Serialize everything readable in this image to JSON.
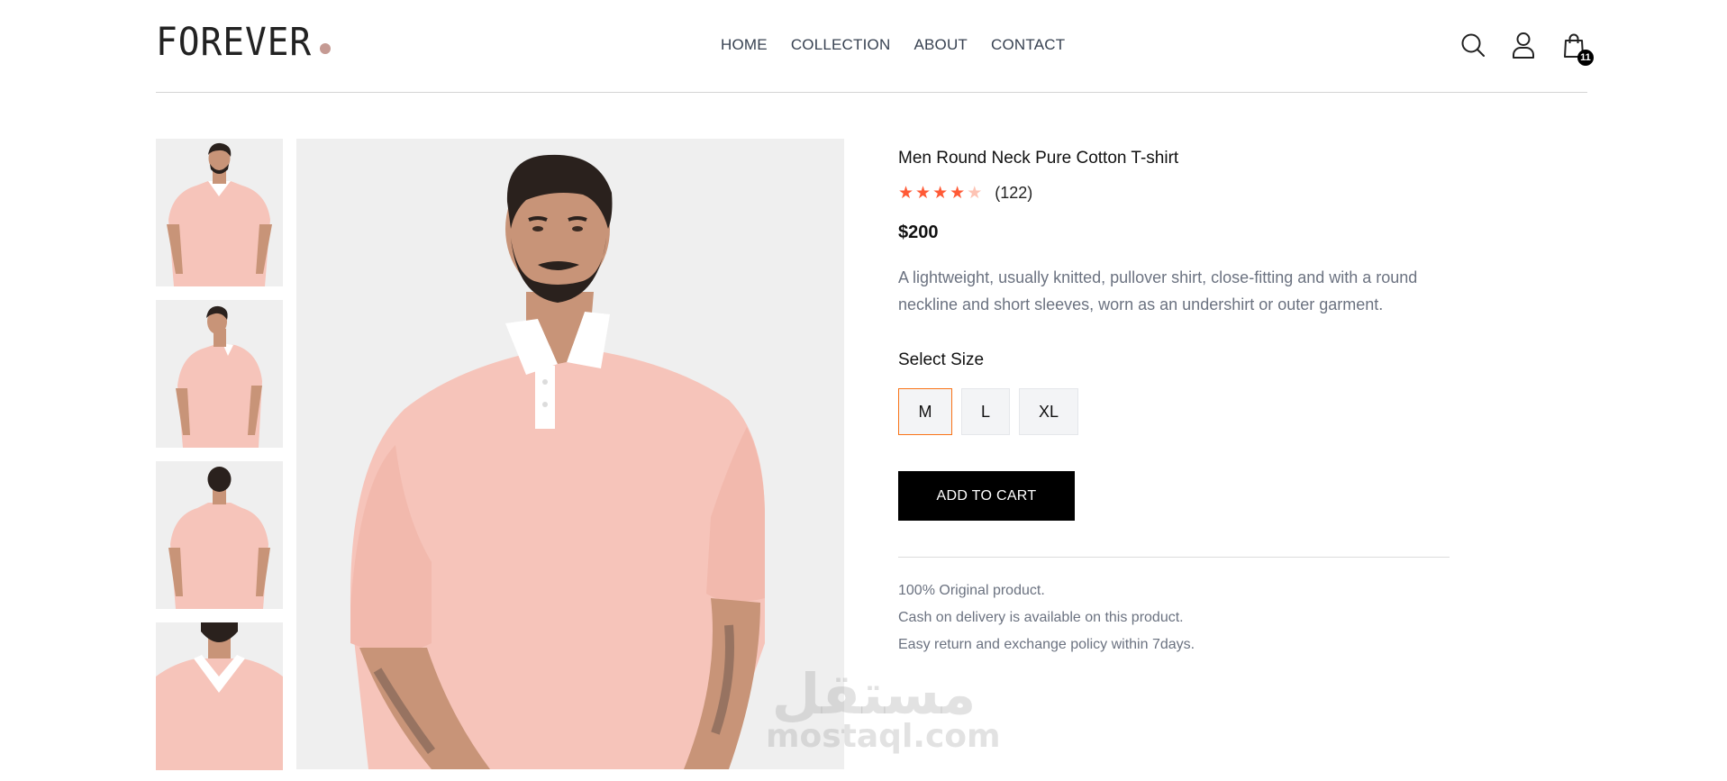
{
  "brand": {
    "logo_text": "FOREVER",
    "dot_color": "#c59a93"
  },
  "nav": {
    "items": [
      {
        "label": "HOME"
      },
      {
        "label": "COLLECTION"
      },
      {
        "label": "ABOUT"
      },
      {
        "label": "CONTACT"
      }
    ]
  },
  "header_icons": {
    "cart_count": "11",
    "icons": [
      "search-icon",
      "user-icon",
      "shopping-bag-icon"
    ]
  },
  "product": {
    "title": "Men Round Neck Pure Cotton T-shirt",
    "rating": 4,
    "rating_max": 5,
    "rating_count": "(122)",
    "price": "$200",
    "description": "A lightweight, usually knitted, pullover shirt, close-fitting and with a round neckline and short sleeves, worn as an undershirt or outer garment.",
    "select_size_label": "Select Size",
    "sizes": [
      {
        "label": "M",
        "selected": true
      },
      {
        "label": "L",
        "selected": false
      },
      {
        "label": "XL",
        "selected": false
      }
    ],
    "add_to_cart_label": "ADD TO CART",
    "policies": [
      "100% Original product.",
      "Cash on delivery is available on this product.",
      "Easy return and exchange policy within 7days."
    ]
  },
  "watermark": {
    "arabic": "مستقل",
    "latin": "mostaql.com"
  },
  "colors": {
    "accent": "#f97316",
    "star": "#ff5a36",
    "star_empty": "#fdc3b4",
    "shirt": "#f6c4ba",
    "skin": "#c89478",
    "hair": "#2a211d"
  }
}
